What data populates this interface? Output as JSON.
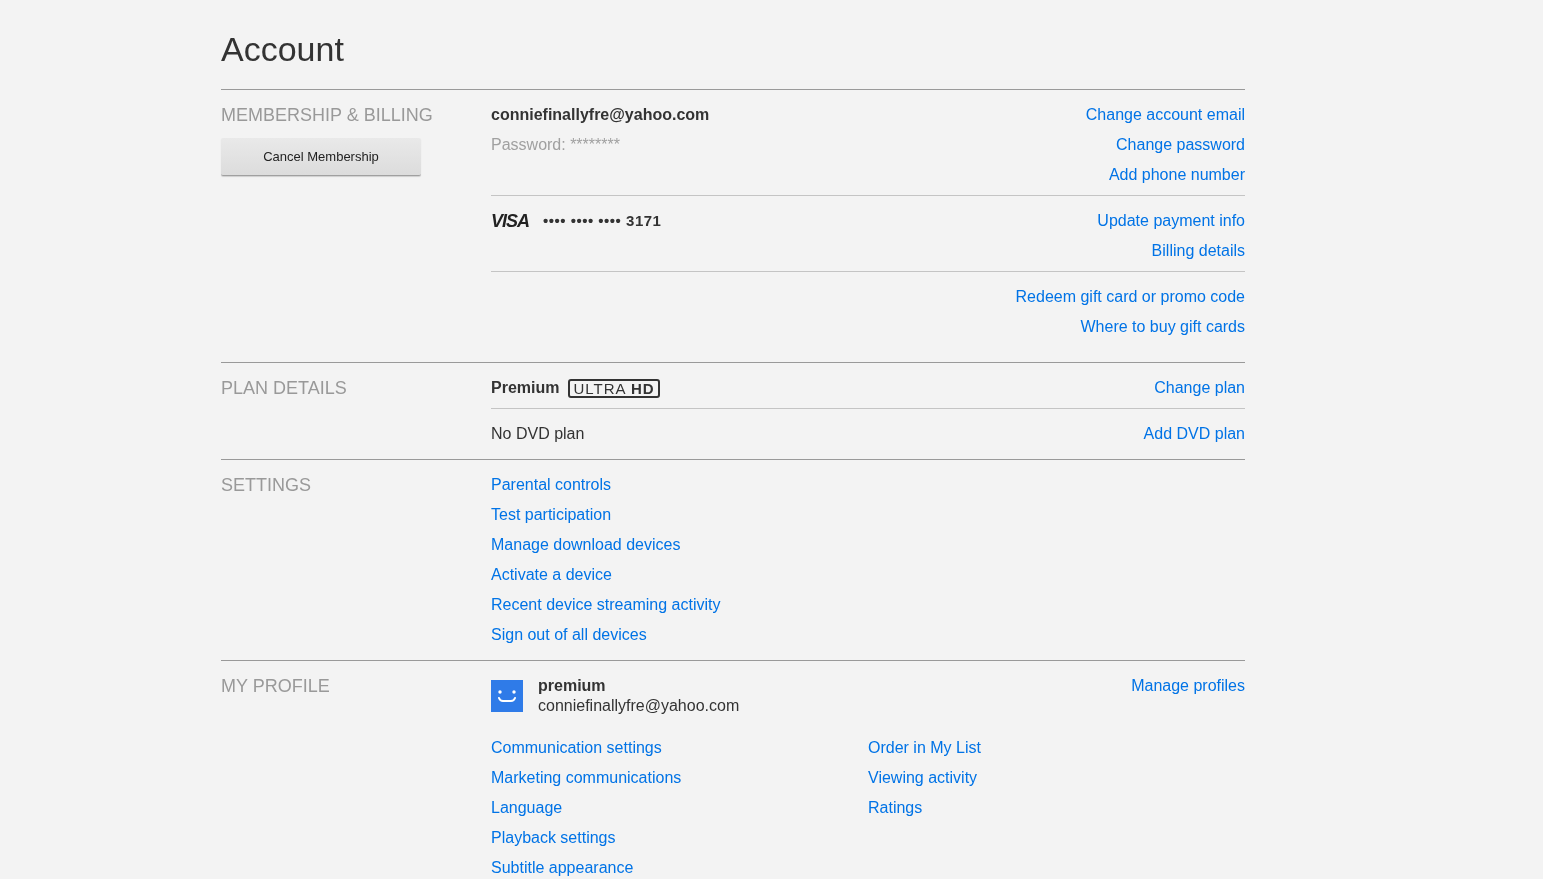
{
  "page": {
    "title": "Account"
  },
  "membership": {
    "heading": "MEMBERSHIP & BILLING",
    "cancel_button": "Cancel Membership",
    "email": "conniefinallyfre@yahoo.com",
    "password": "Password: ********",
    "account_links": [
      "Change account email",
      "Change password",
      "Add phone number"
    ],
    "card": {
      "brand": "VISA",
      "number": "•••• •••• •••• 3171"
    },
    "payment_links": [
      "Update payment info",
      "Billing details"
    ],
    "gift_links": [
      "Redeem gift card or promo code",
      "Where to buy gift cards"
    ]
  },
  "plan": {
    "heading": "PLAN DETAILS",
    "name": "Premium",
    "quality_badge": "ULTRA **HD**",
    "change_link": "Change plan",
    "dvd_plan": "No DVD plan",
    "dvd_link": "Add DVD plan"
  },
  "settings": {
    "heading": "SETTINGS",
    "links": [
      "Parental controls",
      "Test participation",
      "Manage download devices",
      "Activate a device",
      "Recent device streaming activity",
      "Sign out of all devices"
    ]
  },
  "profile": {
    "heading": "MY PROFILE",
    "name": "premium",
    "email": "conniefinallyfre@yahoo.com",
    "manage_link": "Manage profiles",
    "links_left": [
      "Communication settings",
      "Marketing communications",
      "Language",
      "Playback settings",
      "Subtitle appearance"
    ],
    "links_right": [
      "Order in My List",
      "Viewing activity",
      "Ratings"
    ]
  }
}
